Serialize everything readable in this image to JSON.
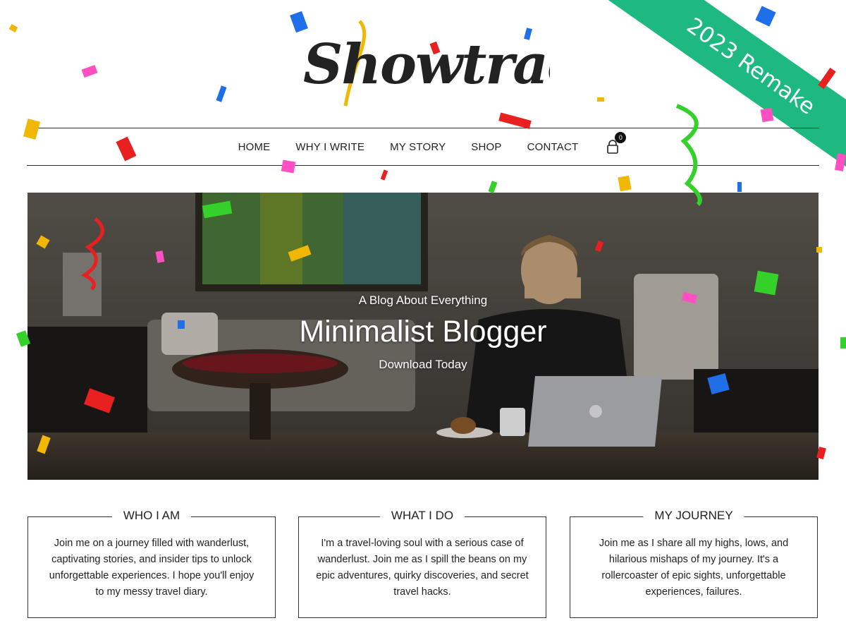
{
  "logo": {
    "text": "Showtrack"
  },
  "ribbon": {
    "label": "2023 Remake"
  },
  "nav": {
    "items": [
      "HOME",
      "WHY I WRITE",
      "MY STORY",
      "SHOP",
      "CONTACT"
    ],
    "cart_count": "0"
  },
  "hero": {
    "subtitle": "A Blog About Everything",
    "title": "Minimalist Blogger",
    "cta": "Download Today"
  },
  "features": [
    {
      "title": "WHO I AM",
      "text": "Join me on a journey filled with wanderlust, captivating stories, and insider tips to unlock unforgettable experiences. I hope you'll enjoy to my messy travel diary."
    },
    {
      "title": "WHAT I DO",
      "text": "I'm a travel-loving soul with a serious case of wanderlust. Join me as I spill the beans on my epic adventures, quirky discoveries, and secret travel hacks."
    },
    {
      "title": "MY JOURNEY",
      "text": "Join me as I share all my highs, lows, and hilarious mishaps of my journey. It's a rollercoaster of epic sights, unforgettable experiences, failures."
    }
  ],
  "colors": {
    "ribbon": "#1db980",
    "text": "#222222",
    "border": "#333333"
  }
}
